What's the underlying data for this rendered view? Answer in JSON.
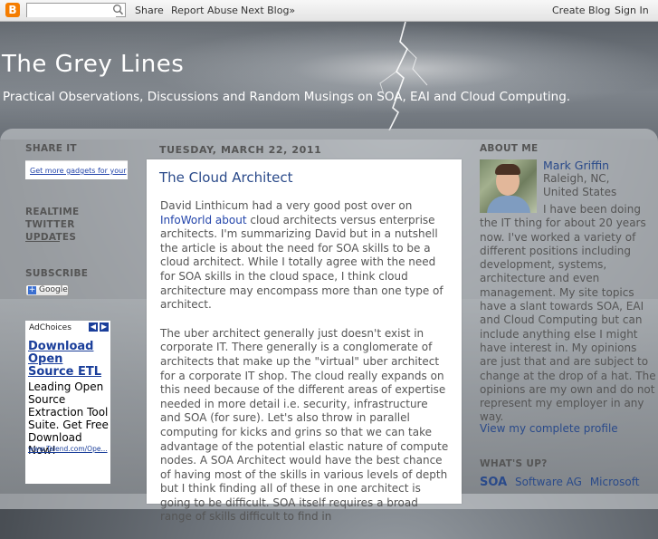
{
  "navbar": {
    "logo": "B",
    "search_placeholder": "",
    "links": [
      "Share",
      "Report Abuse",
      "Next Blog»"
    ],
    "create_blog": "Create Blog",
    "sign_in": "Sign In"
  },
  "header": {
    "title": "The Grey Lines",
    "description": "Practical Observations, Discussions and Random Musings on SOA, EAI and Cloud Computing."
  },
  "left_sidebar": {
    "share_heading": "SHARE IT",
    "gadget_link": "Get more gadgets for your",
    "twitter_heading": "REALTIME TWITTER UPDATES",
    "subscribe_heading": "SUBSCRIBE",
    "google_label": "Google",
    "ad": {
      "choices": "AdChoices",
      "title": "Download Open Source ETL",
      "body": "Leading Open Source Extraction Tool Suite. Get Free Download Now!",
      "url": "www.Talend.com/Ope..."
    }
  },
  "post": {
    "date": "TUESDAY, MARCH 22, 2011",
    "title": "The Cloud Architect",
    "p1_before": "David Linthicum had a very good post over on ",
    "p1_link": "InfoWorld about",
    "p1_after": " cloud architects versus enterprise architects. I'm summarizing David but in a nutshell the article is about the need for SOA skills to be a cloud architect. While I totally agree with the need for SOA skills in the cloud space, I think cloud architecture may encompass more than one type of architect.",
    "p2": "The uber architect generally just doesn't exist in corporate IT. There generally is a conglomerate of architects that make up the \"virtual\" uber architect for a corporate IT shop. The cloud really expands on this need because of the different areas of expertise needed in more detail i.e. security, infrastructure and SOA (for sure). Let's also throw in parallel computing for kicks and grins so that we can take advantage of the potential elastic nature of compute nodes. A SOA Architect would have the best chance of having most of the skills in various levels of depth but I think finding all of these in one architect is going to be difficult. SOA itself requires a broad range of skills difficult to find in"
  },
  "right_sidebar": {
    "about_heading": "ABOUT ME",
    "name": "Mark Griffin",
    "location": "Raleigh, NC, United States",
    "description": "I have been doing the IT thing for about 20 years now. I've worked a variety of different positions including development, systems, architecture and even management. My site topics have a slant towards SOA, EAI and Cloud Computing but can include anything else I might have interest in. My opinions are just that and are subject to change at the drop of a hat. The opinions are my own and do not represent my employer in any way.",
    "profile_link": "View my complete profile",
    "whats_up_heading": "WHAT'S UP?",
    "tags": [
      "SOA",
      "Software AG",
      "Microsoft"
    ]
  }
}
